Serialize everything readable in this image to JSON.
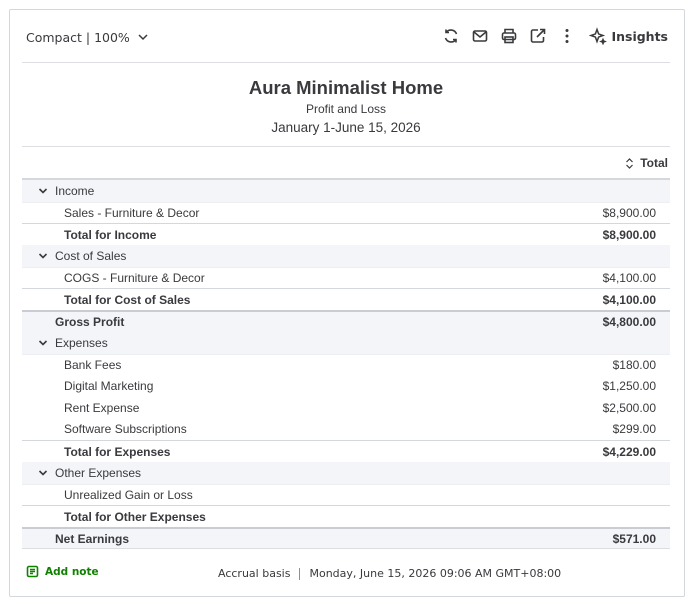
{
  "toolbar": {
    "view_label": "Compact | 100%",
    "insights_label": "Insights",
    "icons": [
      "refresh-icon",
      "email-icon",
      "print-icon",
      "export-icon",
      "more-icon",
      "insights-icon"
    ]
  },
  "report": {
    "company": "Aura Minimalist Home",
    "title": "Profit and Loss",
    "period": "January 1-June 15, 2026",
    "column_header": "Total"
  },
  "rows": {
    "income": {
      "label": "Income"
    },
    "sales": {
      "label": "Sales - Furniture & Decor",
      "amount": "$8,900.00"
    },
    "total_income": {
      "label": "Total for Income",
      "amount": "$8,900.00"
    },
    "cost_of_sales": {
      "label": "Cost of Sales"
    },
    "cogs": {
      "label": "COGS - Furniture & Decor",
      "amount": "$4,100.00"
    },
    "total_cos": {
      "label": "Total for Cost of Sales",
      "amount": "$4,100.00"
    },
    "gross_profit": {
      "label": "Gross Profit",
      "amount": "$4,800.00"
    },
    "expenses": {
      "label": "Expenses"
    },
    "bank_fees": {
      "label": "Bank Fees",
      "amount": "$180.00"
    },
    "digital_marketing": {
      "label": "Digital Marketing",
      "amount": "$1,250.00"
    },
    "rent": {
      "label": "Rent Expense",
      "amount": "$2,500.00"
    },
    "software": {
      "label": "Software Subscriptions",
      "amount": "$299.00"
    },
    "total_expenses": {
      "label": "Total for Expenses",
      "amount": "$4,229.00"
    },
    "other_expenses": {
      "label": "Other Expenses"
    },
    "unrealized": {
      "label": "Unrealized Gain or Loss",
      "amount": ""
    },
    "total_other": {
      "label": "Total for Other Expenses",
      "amount": ""
    },
    "net_earnings": {
      "label": "Net Earnings",
      "amount": "$571.00"
    }
  },
  "footer": {
    "add_note": "Add note",
    "basis": "Accrual basis",
    "timestamp": "Monday, June 15, 2026 09:06 AM GMT+08:00"
  },
  "colors": {
    "text": "#393a3d",
    "accent_green": "#108000",
    "section_bg": "#f4f5f8",
    "border": "#d4d7dc"
  }
}
